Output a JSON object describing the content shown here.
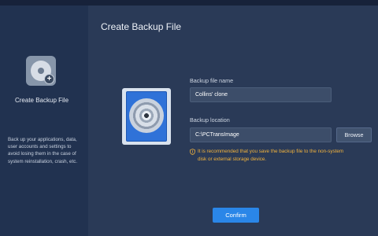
{
  "sidebar": {
    "title": "Create Backup File",
    "description": "Back up your applications, data, user accounts and settings to avoid losing them in the case of system reinstallation, crash, etc.",
    "icon": "backup-disc-plus-icon"
  },
  "main": {
    "title": "Create Backup File",
    "backup_name_label": "Backup file name",
    "backup_name_value": "Collins' clone",
    "backup_location_label": "Backup location",
    "backup_location_value": "C:\\PCTransImage",
    "browse_label": "Browse",
    "warning_text": "It is recommended that you save the backup file to the non-system disk or external storage device.",
    "confirm_label": "Confirm"
  },
  "colors": {
    "background": "#1b2941",
    "sidebar": "#213250",
    "panel": "#2a3a57",
    "accent": "#2a86e8",
    "warning": "#f2b33d"
  }
}
